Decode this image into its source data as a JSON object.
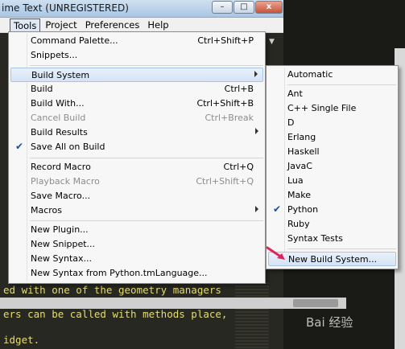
{
  "window": {
    "title": "ime Text (UNREGISTERED)",
    "minimize": "–",
    "maximize": "□",
    "close": "x"
  },
  "menubar": {
    "items": [
      "Tools",
      "Project",
      "Preferences",
      "Help"
    ]
  },
  "tools_menu": {
    "items": [
      {
        "label": "Command Palette...",
        "shortcut": "Ctrl+Shift+P"
      },
      {
        "label": "Snippets..."
      },
      {
        "label": "Build System",
        "submenu": true
      },
      {
        "label": "Build",
        "shortcut": "Ctrl+B"
      },
      {
        "label": "Build With...",
        "shortcut": "Ctrl+Shift+B"
      },
      {
        "label": "Cancel Build",
        "shortcut": "Ctrl+Break",
        "disabled": true
      },
      {
        "label": "Build Results",
        "submenu": true
      },
      {
        "label": "Save All on Build",
        "checked": true
      },
      {
        "label": "Record Macro",
        "shortcut": "Ctrl+Q"
      },
      {
        "label": "Playback Macro",
        "shortcut": "Ctrl+Shift+Q",
        "disabled": true
      },
      {
        "label": "Save Macro...",
        "disabled": false
      },
      {
        "label": "Macros",
        "submenu": true
      },
      {
        "label": "New Plugin..."
      },
      {
        "label": "New Snippet..."
      },
      {
        "label": "New Syntax..."
      },
      {
        "label": "New Syntax from Python.tmLanguage..."
      }
    ]
  },
  "build_system_submenu": {
    "items": [
      {
        "label": "Automatic"
      },
      {
        "label": "Ant"
      },
      {
        "label": "C++ Single File"
      },
      {
        "label": "D"
      },
      {
        "label": "Erlang"
      },
      {
        "label": "Haskell"
      },
      {
        "label": "JavaC"
      },
      {
        "label": "Lua"
      },
      {
        "label": "Make"
      },
      {
        "label": "Python",
        "checked": true
      },
      {
        "label": "Ruby"
      },
      {
        "label": "Syntax Tests"
      },
      {
        "label": "New Build System...",
        "highlighted": true
      }
    ]
  },
  "editor": {
    "lines": [
      "ed with one of the geometry managers",
      "ers can be called with methods place,",
      "idget."
    ],
    "gutter_arrow": "▼"
  },
  "watermark": "Bai 经验",
  "colors": {
    "editor_bg": "#272822",
    "code_text": "#e6db74",
    "menu_bg": "#f7f7f7",
    "highlight": "#d4e3f5",
    "pointer_arrow": "#e0245e"
  }
}
